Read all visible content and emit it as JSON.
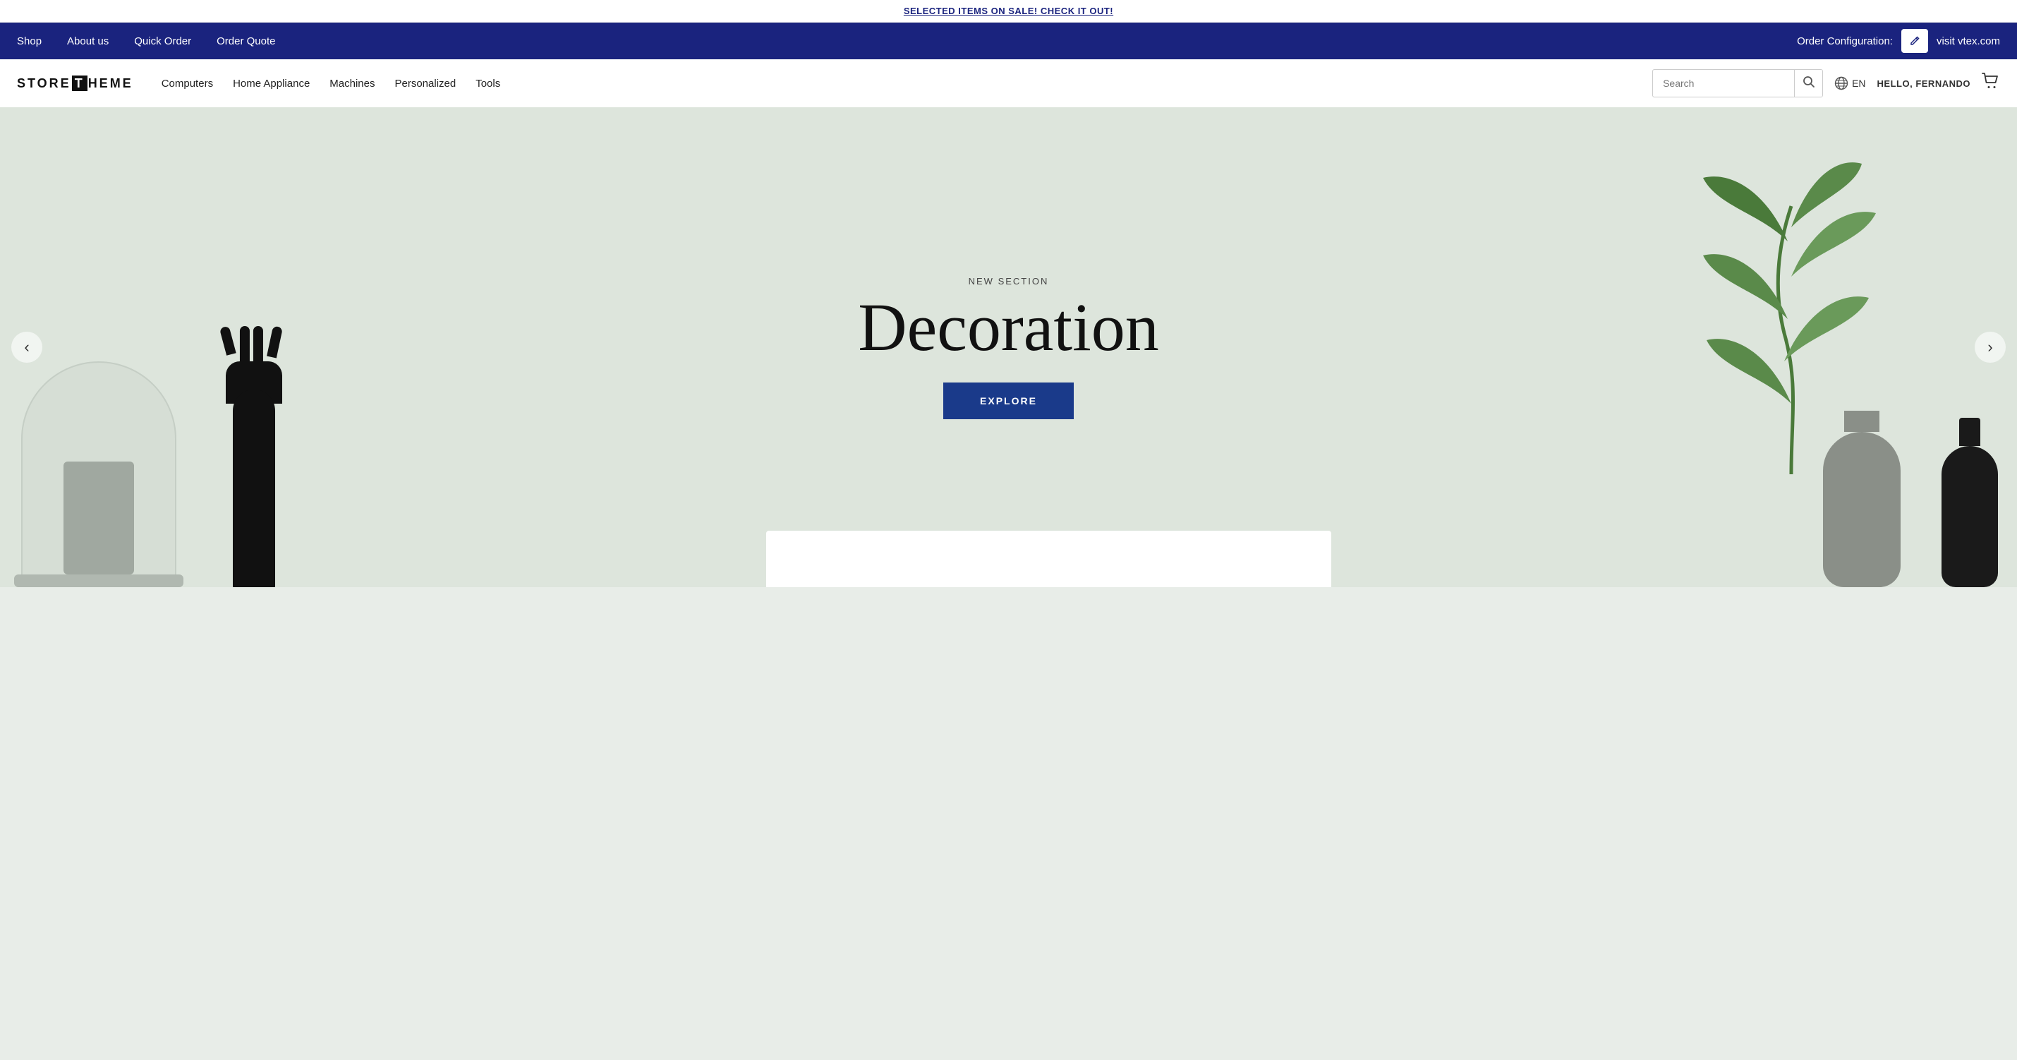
{
  "banner": {
    "text": "SELECTED ITEMS ON SALE! CHECK IT OUT!"
  },
  "top_nav": {
    "items": [
      "Shop",
      "About us",
      "Quick Order",
      "Order Quote"
    ],
    "order_config_label": "Order Configuration:",
    "visit_label": "visit vtex.com",
    "edit_icon": "✎"
  },
  "main_nav": {
    "logo_text": "STORE THEME",
    "links": [
      "Computers",
      "Home Appliance",
      "Machines",
      "Personalized",
      "Tools"
    ],
    "search_placeholder": "Search",
    "lang": "EN",
    "user_greeting": "HELLO, FERNANDO",
    "cart_icon": "🛒"
  },
  "hero": {
    "subtitle": "NEW SECTION",
    "title": "Decoration",
    "explore_label": "EXPLORE"
  },
  "slider": {
    "prev_label": "‹",
    "next_label": "›"
  }
}
